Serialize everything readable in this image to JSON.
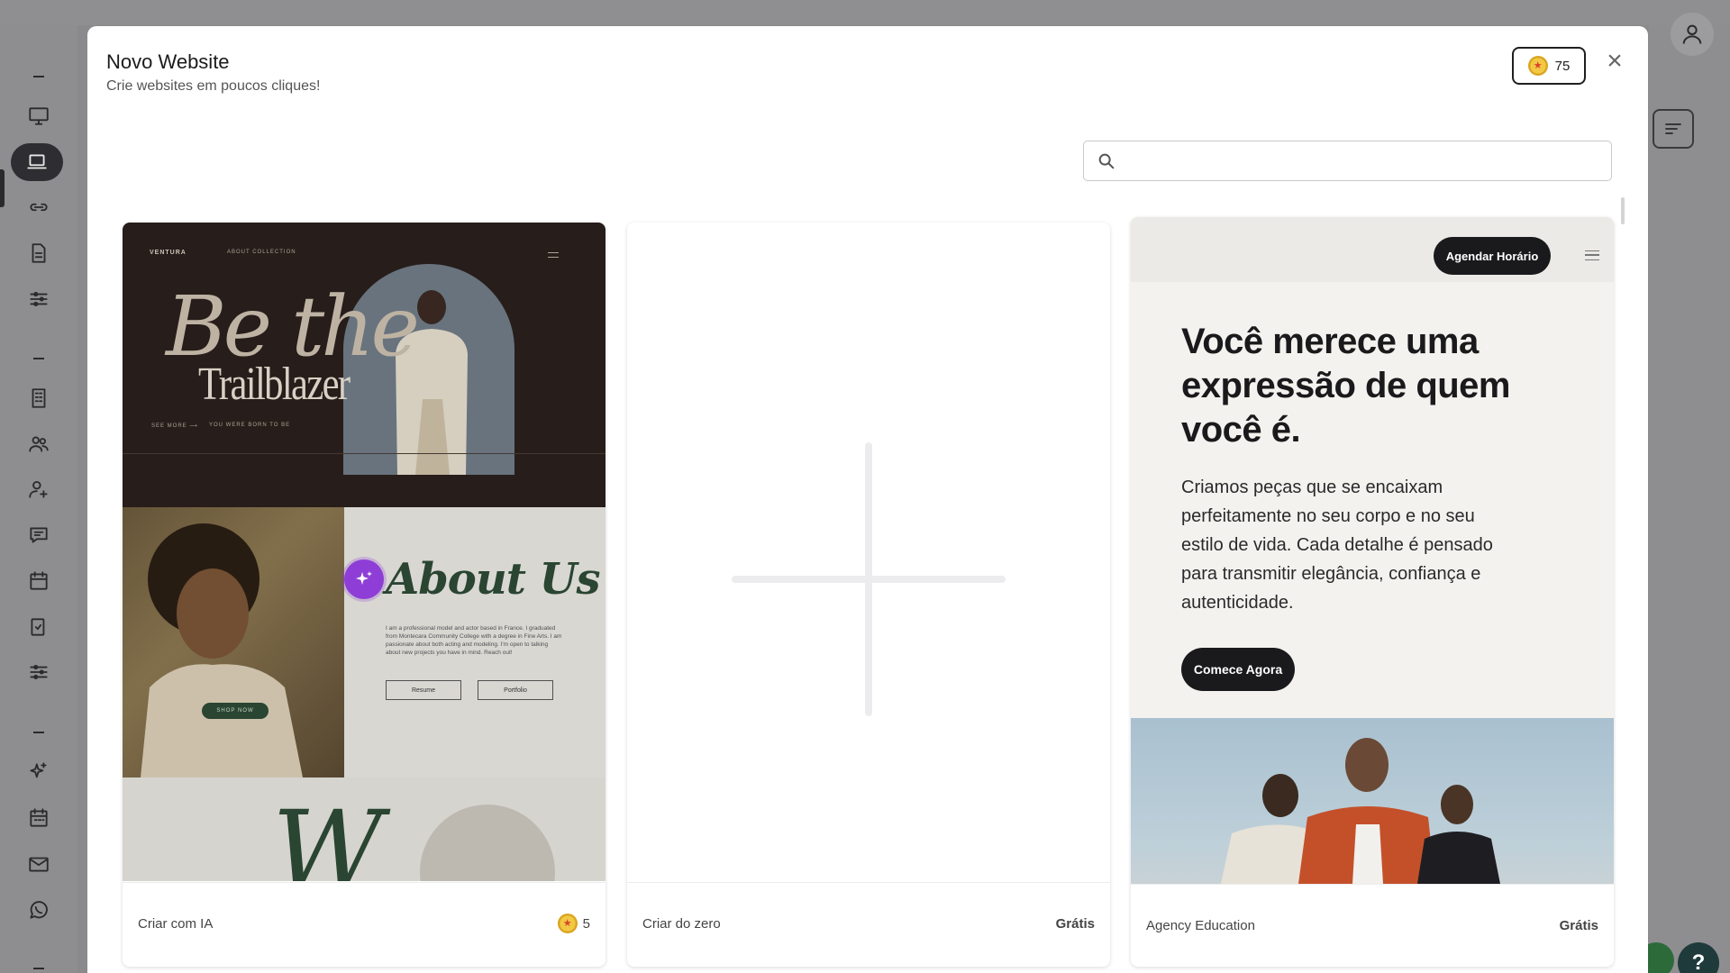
{
  "modal": {
    "title": "Novo Website",
    "subtitle": "Crie websites em poucos cliques!",
    "credits": "75",
    "close_label": "×"
  },
  "search": {
    "placeholder": "",
    "value": ""
  },
  "cards": [
    {
      "label": "Criar com IA",
      "cost": "5",
      "preview": {
        "brand": "VENTURA",
        "nav": "ABOUT     COLLECTION",
        "hero_line1": "Be the",
        "hero_line2": "Trailblazer",
        "tag1": "SEE MORE  ⟶",
        "tag2": "YOU WERE BORN TO BE",
        "about_title": "About Us",
        "about_text": "I am a professional model and actor based in France. I graduated from Montecara Community College with a degree in Fine Arts. I am passionate about both acting and modeling. I'm open to talking about new projects you have in mind. Reach out!",
        "btn_resume": "Resume",
        "btn_portfolio": "Portfolio",
        "shop_now": "SHOP NOW",
        "big_letter": "W"
      }
    },
    {
      "label": "Criar do zero",
      "price": "Grátis"
    },
    {
      "label": "Agency Education",
      "price": "Grátis",
      "preview": {
        "book_button": "Agendar Horário",
        "headline": "Você merece uma expressão de quem você é.",
        "body": "Criamos peças que se encaixam perfeitamente no seu corpo e no seu estilo de vida. Cada detalhe é pensado para transmitir elegância, confiança e autenticidade.",
        "cta": "Comece Agora"
      }
    }
  ],
  "help_label": "?",
  "colors": {
    "accent_ai": "#8e3ed6",
    "dark": "#1a1a1c",
    "coin": "#f3c844"
  },
  "icons": {
    "sidebar": [
      "monitor-icon",
      "laptop-icon",
      "link-icon",
      "document-icon",
      "sliders-icon",
      "building-icon",
      "users-icon",
      "user-plus-icon",
      "chat-icon",
      "calendar-icon",
      "clipboard-check-icon",
      "sliders-icon",
      "sparkles-icon",
      "calendar-grid-icon",
      "mail-icon",
      "whatsapp-icon"
    ]
  }
}
